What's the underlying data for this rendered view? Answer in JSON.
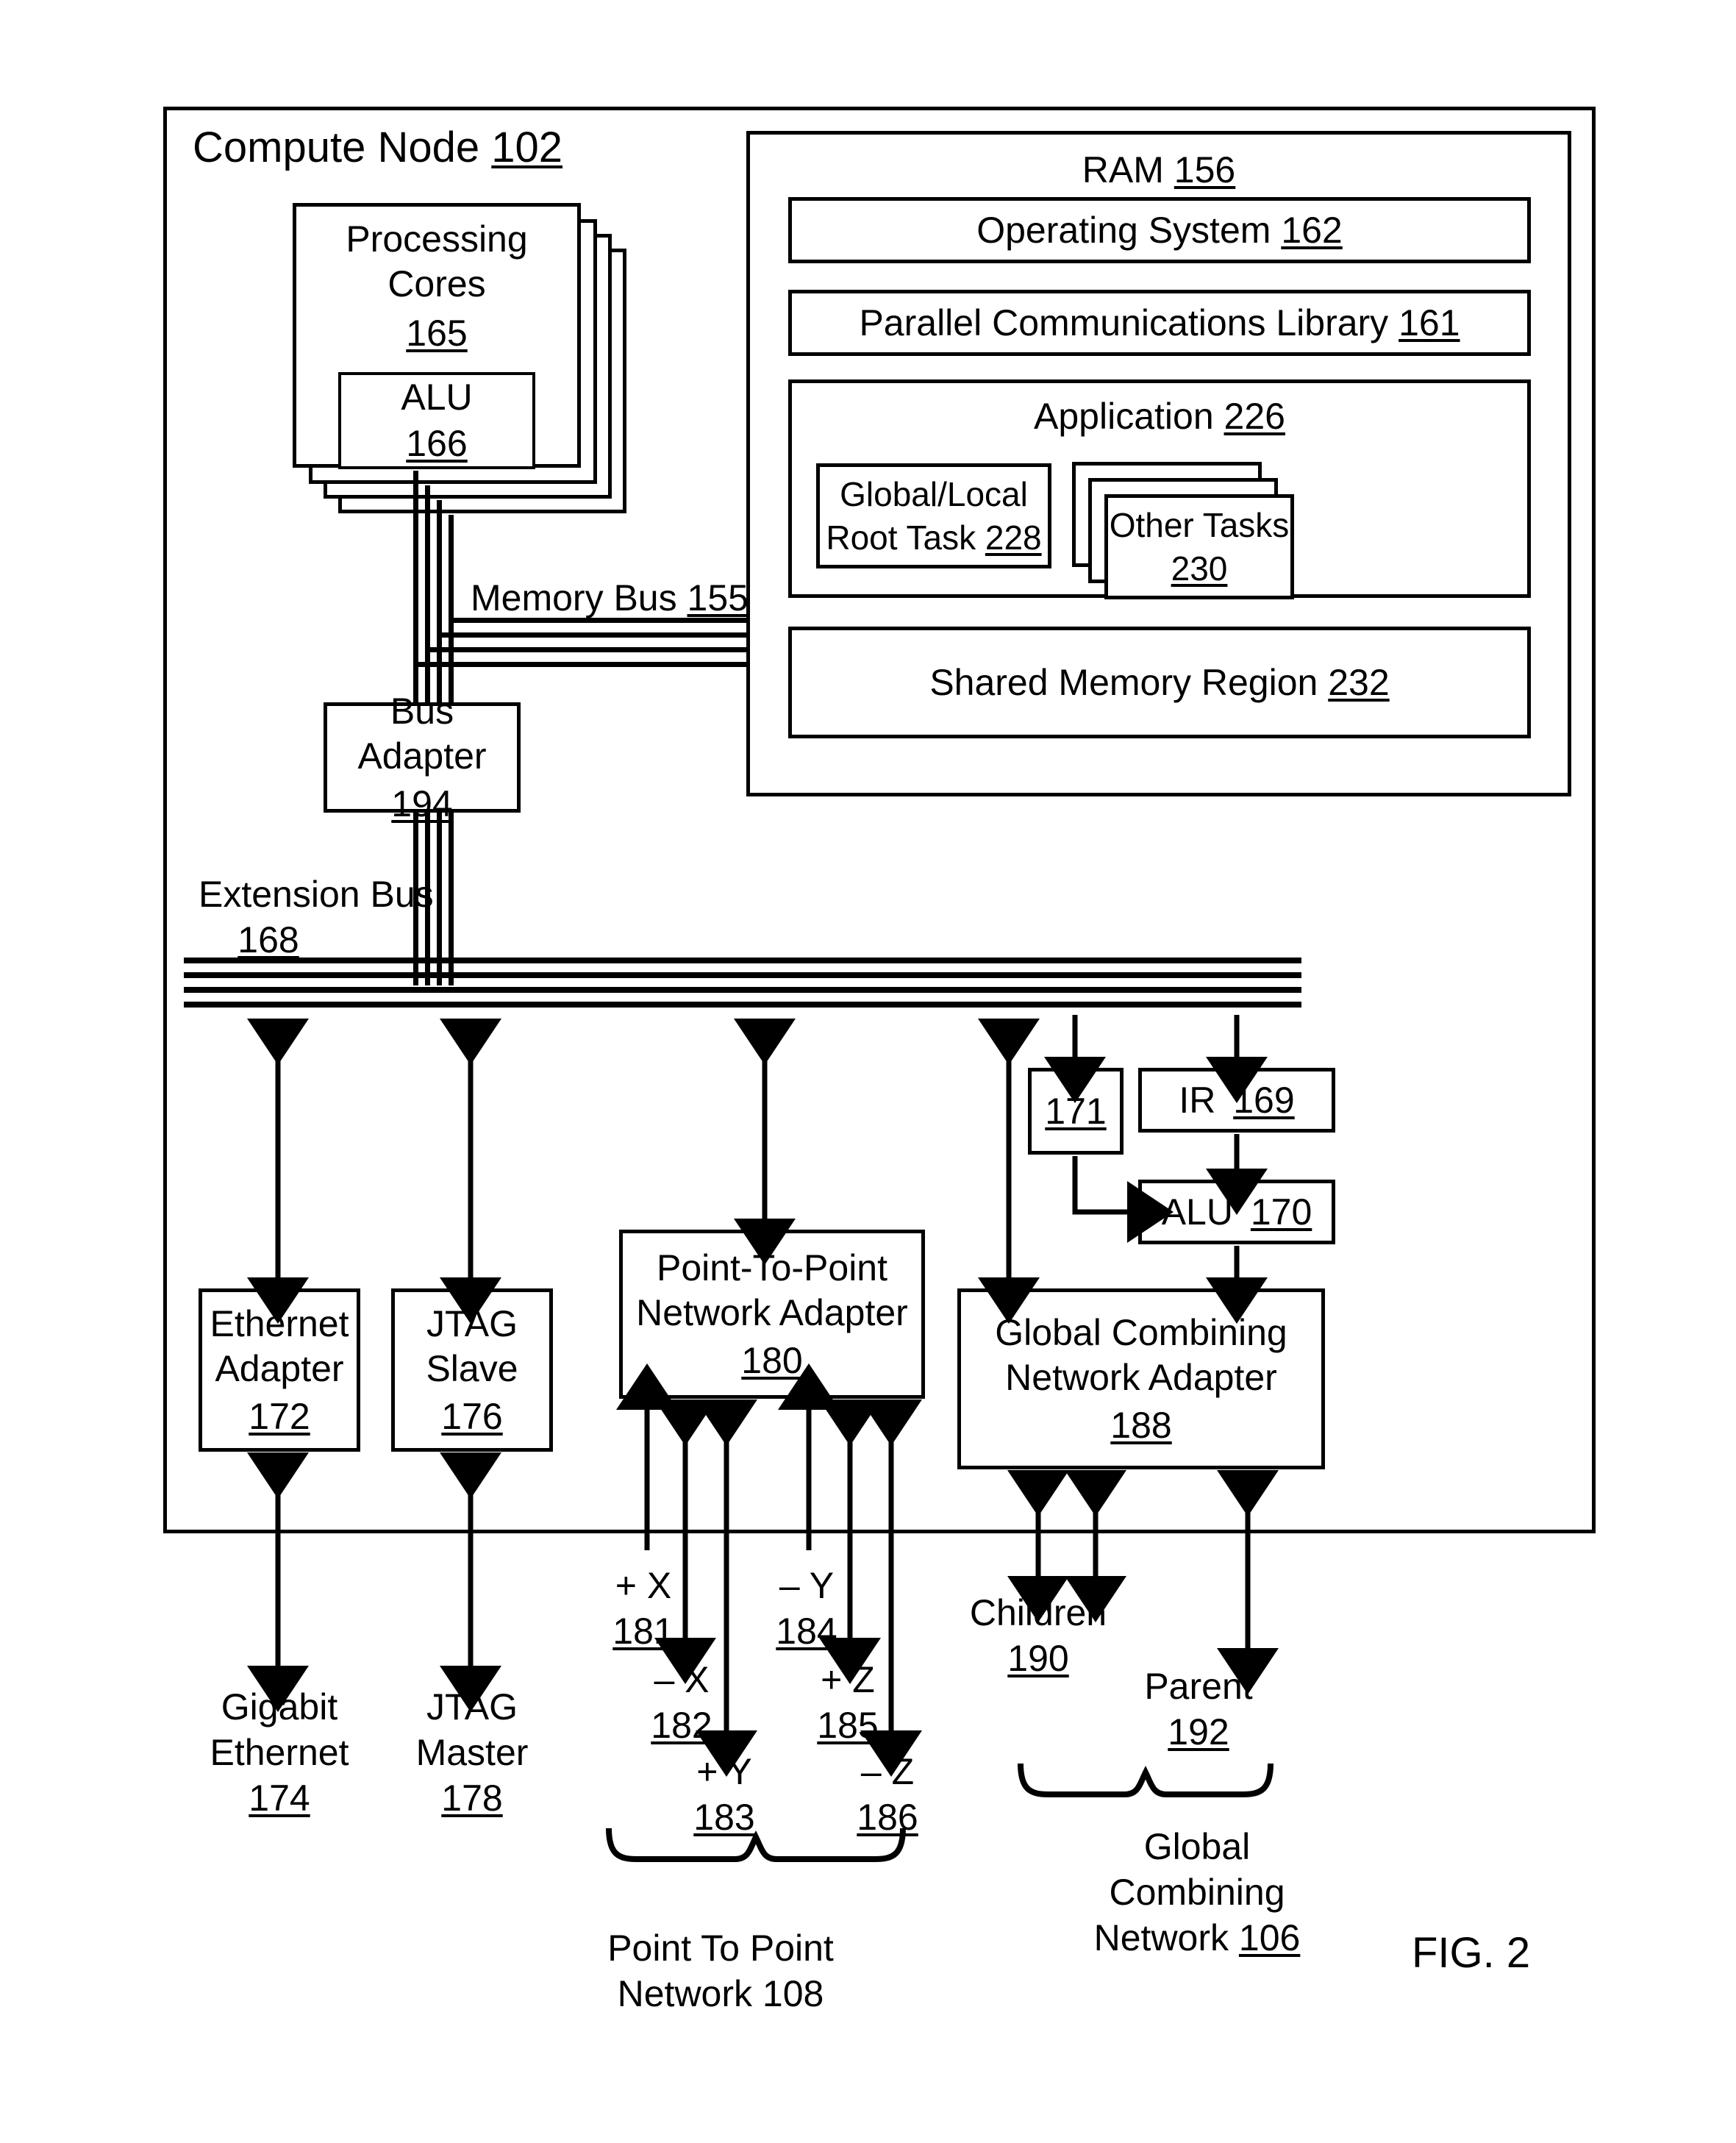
{
  "figure": {
    "caption": "FIG. 2"
  },
  "compute_node": {
    "title": "Compute Node",
    "ref": "102"
  },
  "processing_cores": {
    "title": "Processing Cores",
    "ref": "165",
    "alu": {
      "title": "ALU",
      "ref": "166"
    }
  },
  "ram": {
    "title": "RAM",
    "ref": "156",
    "operating_system": {
      "title": "Operating System",
      "ref": "162"
    },
    "parallel_comm_library": {
      "title": "Parallel Communications Library",
      "ref": "161"
    },
    "application": {
      "title": "Application",
      "ref": "226",
      "root_task": {
        "line1": "Global/Local",
        "line2": "Root Task",
        "ref": "228"
      },
      "other_tasks": {
        "title": "Other Tasks",
        "ref": "230"
      }
    },
    "shared_memory_region": {
      "title": "Shared Memory Region",
      "ref": "232"
    }
  },
  "memory_bus": {
    "title": "Memory Bus",
    "ref": "155"
  },
  "bus_adapter": {
    "title": "Bus Adapter",
    "ref": "194"
  },
  "extension_bus": {
    "title": "Extension Bus",
    "ref": "168"
  },
  "ethernet_adapter": {
    "line1": "Ethernet",
    "line2": "Adapter",
    "ref": "172"
  },
  "jtag_slave": {
    "line1": "JTAG",
    "line2": "Slave",
    "ref": "176"
  },
  "point_to_point_adapter": {
    "line1": "Point-To-Point",
    "line2": "Network Adapter",
    "ref": "180"
  },
  "global_combining_adapter": {
    "line1": "Global Combining",
    "line2": "Network Adapter",
    "ref": "188"
  },
  "register_171": {
    "ref": "171"
  },
  "ir": {
    "title": "IR",
    "ref": "169"
  },
  "alu_170": {
    "title": "ALU",
    "ref": "170"
  },
  "gigabit_ethernet": {
    "line1": "Gigabit",
    "line2": "Ethernet",
    "ref": "174"
  },
  "jtag_master": {
    "line1": "JTAG",
    "line2": "Master",
    "ref": "178"
  },
  "axes": [
    {
      "sign": "+ X",
      "ref": "181"
    },
    {
      "sign": "– X",
      "ref": "182"
    },
    {
      "sign": "+ Y",
      "ref": "183"
    },
    {
      "sign": "– Y",
      "ref": "184"
    },
    {
      "sign": "+ Z",
      "ref": "185"
    },
    {
      "sign": "– Z",
      "ref": "186"
    }
  ],
  "children": {
    "title": "Children",
    "ref": "190"
  },
  "parent": {
    "title": "Parent",
    "ref": "192"
  },
  "point_to_point_network": {
    "line1": "Point To Point",
    "line2": "Network 108"
  },
  "global_combining_network": {
    "line1": "Global",
    "line2": "Combining",
    "line3_text": "Network ",
    "ref": "106"
  },
  "colors": {
    "ink": "#000000",
    "paper": "#ffffff"
  }
}
